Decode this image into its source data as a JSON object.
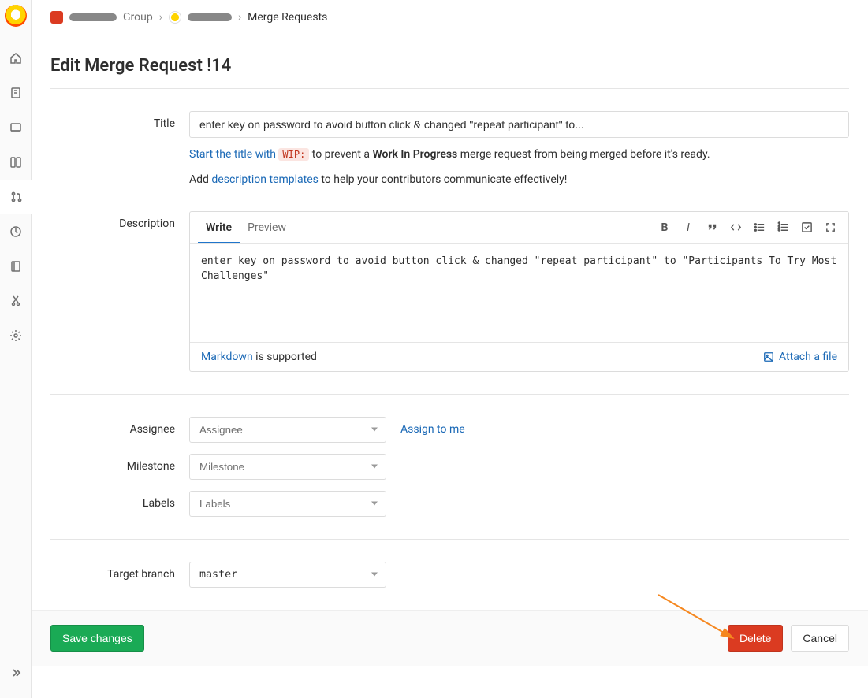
{
  "breadcrumbs": {
    "group_label": "Group",
    "current": "Merge Requests"
  },
  "page": {
    "title": "Edit Merge Request !14"
  },
  "form": {
    "title": {
      "label": "Title",
      "value": "enter key on password to avoid button click & changed \"repeat participant\" to..."
    },
    "wip_help": {
      "prefix": "Start the title with ",
      "code": "WIP:",
      "mid": " to prevent a ",
      "bold": "Work In Progress",
      "suffix": " merge request from being merged before it's ready."
    },
    "template_help": {
      "prefix": "Add ",
      "link": "description templates",
      "suffix": " to help your contributors communicate effectively!"
    },
    "description": {
      "label": "Description",
      "tabs": {
        "write": "Write",
        "preview": "Preview"
      },
      "value": "enter key on password to avoid button click & changed \"repeat participant\" to \"Participants To Try Most Challenges\"",
      "markdown_link": "Markdown",
      "markdown_suffix": " is supported",
      "attach": "Attach a file"
    },
    "assignee": {
      "label": "Assignee",
      "placeholder": "Assignee",
      "assign_me": "Assign to me"
    },
    "milestone": {
      "label": "Milestone",
      "placeholder": "Milestone"
    },
    "labels": {
      "label": "Labels",
      "placeholder": "Labels"
    },
    "target_branch": {
      "label": "Target branch",
      "value": "master"
    }
  },
  "buttons": {
    "save": "Save changes",
    "delete": "Delete",
    "cancel": "Cancel"
  }
}
